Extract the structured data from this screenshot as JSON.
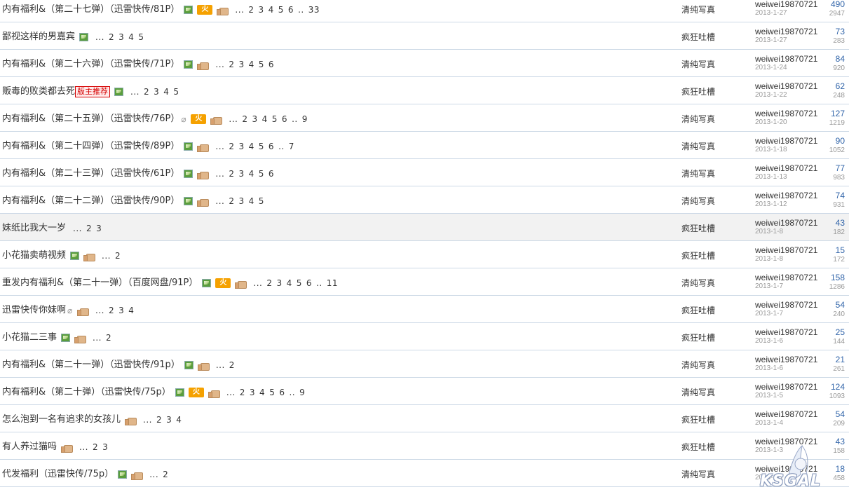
{
  "threads": [
    {
      "title": "内有福利&（第二十七弹）（迅雷快传/81P）",
      "icons": [
        "img",
        "hot",
        "thumb"
      ],
      "pages": [
        "...",
        "2",
        "3",
        "4",
        "5",
        "6",
        "..",
        "33"
      ],
      "category": "清纯写真",
      "author": "weiwei19870721",
      "date": "2013-1-27",
      "replies": "490",
      "views": "2947"
    },
    {
      "title": "鄙视这样的男嘉宾",
      "icons": [
        "img"
      ],
      "pages": [
        "...",
        "2",
        "3",
        "4",
        "5"
      ],
      "category": "疯狂吐槽",
      "author": "weiwei19870721",
      "date": "2013-1-27",
      "replies": "73",
      "views": "283"
    },
    {
      "title": "内有福利&（第二十六弹）（迅雷快传/71P）",
      "icons": [
        "img",
        "thumb"
      ],
      "pages": [
        "...",
        "2",
        "3",
        "4",
        "5",
        "6"
      ],
      "category": "清纯写真",
      "author": "weiwei19870721",
      "date": "2013-1-24",
      "replies": "84",
      "views": "920"
    },
    {
      "title": "贩毒的败类都去死",
      "icons": [
        "admin",
        "img"
      ],
      "admin_tag": "版主推荐",
      "pages": [
        "...",
        "2",
        "3",
        "4",
        "5"
      ],
      "category": "疯狂吐槽",
      "author": "weiwei19870721",
      "date": "2013-1-22",
      "replies": "62",
      "views": "248"
    },
    {
      "title": "内有福利&（第二十五弹）（迅雷快传/76P）",
      "icons": [
        "clip",
        "hot",
        "thumb"
      ],
      "pages": [
        "...",
        "2",
        "3",
        "4",
        "5",
        "6",
        "..",
        "9"
      ],
      "category": "清纯写真",
      "author": "weiwei19870721",
      "date": "2013-1-20",
      "replies": "127",
      "views": "1219"
    },
    {
      "title": "内有福利&（第二十四弹）（迅雷快传/89P）",
      "icons": [
        "img",
        "thumb"
      ],
      "pages": [
        "...",
        "2",
        "3",
        "4",
        "5",
        "6",
        "..",
        "7"
      ],
      "category": "清纯写真",
      "author": "weiwei19870721",
      "date": "2013-1-18",
      "replies": "90",
      "views": "1052"
    },
    {
      "title": "内有福利&（第二十三弹）（迅雷快传/61P）",
      "icons": [
        "img",
        "thumb"
      ],
      "pages": [
        "...",
        "2",
        "3",
        "4",
        "5",
        "6"
      ],
      "category": "清纯写真",
      "author": "weiwei19870721",
      "date": "2013-1-13",
      "replies": "77",
      "views": "983"
    },
    {
      "title": "内有福利&（第二十二弹）（迅雷快传/90P）",
      "icons": [
        "img",
        "thumb"
      ],
      "pages": [
        "...",
        "2",
        "3",
        "4",
        "5"
      ],
      "category": "清纯写真",
      "author": "weiwei19870721",
      "date": "2013-1-12",
      "replies": "74",
      "views": "931"
    },
    {
      "title": "妹纸比我大一岁",
      "icons": [],
      "pages": [
        "...",
        "2",
        "3"
      ],
      "category": "疯狂吐槽",
      "author": "weiwei19870721",
      "date": "2013-1-8",
      "replies": "43",
      "views": "182",
      "highlight": true
    },
    {
      "title": "小花猫卖萌视频",
      "icons": [
        "img",
        "thumb"
      ],
      "pages": [
        "...",
        "2"
      ],
      "category": "疯狂吐槽",
      "author": "weiwei19870721",
      "date": "2013-1-8",
      "replies": "15",
      "views": "172"
    },
    {
      "title": "重发内有福利&（第二十一弹）（百度网盘/91P）",
      "icons": [
        "img",
        "hot",
        "thumb"
      ],
      "pages": [
        "...",
        "2",
        "3",
        "4",
        "5",
        "6",
        "..",
        "11"
      ],
      "category": "清纯写真",
      "author": "weiwei19870721",
      "date": "2013-1-7",
      "replies": "158",
      "views": "1286"
    },
    {
      "title": "迅雷快传你妹啊",
      "icons": [
        "clip",
        "thumb"
      ],
      "pages": [
        "...",
        "2",
        "3",
        "4"
      ],
      "category": "疯狂吐槽",
      "author": "weiwei19870721",
      "date": "2013-1-7",
      "replies": "54",
      "views": "240"
    },
    {
      "title": "小花猫二三事",
      "icons": [
        "img",
        "thumb"
      ],
      "pages": [
        "...",
        "2"
      ],
      "category": "疯狂吐槽",
      "author": "weiwei19870721",
      "date": "2013-1-6",
      "replies": "25",
      "views": "144"
    },
    {
      "title": "内有福利&（第二十一弹）（迅雷快传/91p）",
      "icons": [
        "img",
        "thumb"
      ],
      "pages": [
        "...",
        "2"
      ],
      "category": "清纯写真",
      "author": "weiwei19870721",
      "date": "2013-1-6",
      "replies": "21",
      "views": "261"
    },
    {
      "title": "内有福利&（第二十弹）（迅雷快传/75p）",
      "icons": [
        "img",
        "hot",
        "thumb"
      ],
      "pages": [
        "...",
        "2",
        "3",
        "4",
        "5",
        "6",
        "..",
        "9"
      ],
      "category": "清纯写真",
      "author": "weiwei19870721",
      "date": "2013-1-5",
      "replies": "124",
      "views": "1093"
    },
    {
      "title": "怎么泡到一名有追求的女孩儿",
      "icons": [
        "thumb"
      ],
      "pages": [
        "...",
        "2",
        "3",
        "4"
      ],
      "category": "疯狂吐槽",
      "author": "weiwei19870721",
      "date": "2013-1-4",
      "replies": "54",
      "views": "209"
    },
    {
      "title": "有人养过猫吗",
      "icons": [
        "thumb"
      ],
      "pages": [
        "...",
        "2",
        "3"
      ],
      "category": "疯狂吐槽",
      "author": "weiwei19870721",
      "date": "2013-1-3",
      "replies": "43",
      "views": "158"
    },
    {
      "title": "代发福利（迅雷快传/75p）",
      "icons": [
        "img",
        "thumb"
      ],
      "pages": [
        "...",
        "2"
      ],
      "category": "清纯写真",
      "author": "weiwei19870721",
      "date": "2013-1-1",
      "replies": "18",
      "views": "458"
    }
  ],
  "hot_label": "火",
  "clip_glyph": "⌀",
  "watermark": {
    "text": "KSGAL"
  }
}
